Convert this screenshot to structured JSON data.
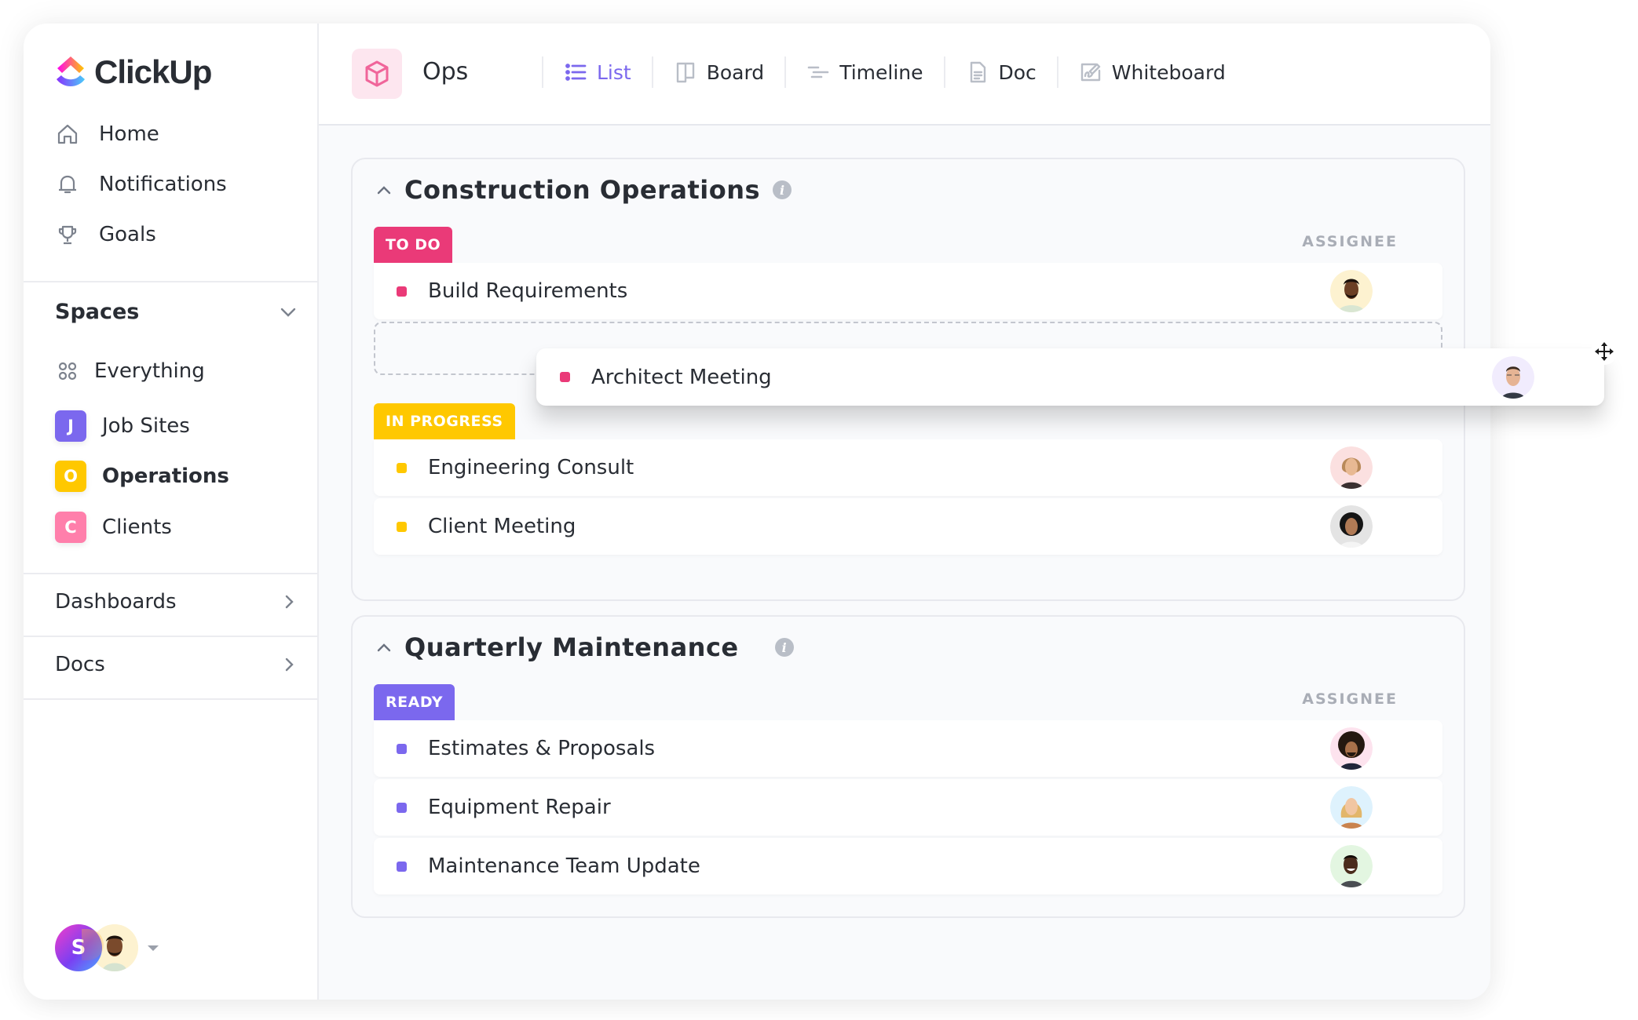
{
  "app": {
    "name": "ClickUp"
  },
  "sidebar": {
    "nav": [
      {
        "label": "Home",
        "icon": "home-icon"
      },
      {
        "label": "Notifications",
        "icon": "bell-icon"
      },
      {
        "label": "Goals",
        "icon": "trophy-icon"
      }
    ],
    "spaces_label": "Spaces",
    "everything_label": "Everything",
    "spaces": [
      {
        "initial": "J",
        "label": "Job Sites",
        "color": "#7b68ee"
      },
      {
        "initial": "O",
        "label": "Operations",
        "color": "#ffc800",
        "active": true
      },
      {
        "initial": "C",
        "label": "Clients",
        "color": "#ff7fab"
      }
    ],
    "dashboards_label": "Dashboards",
    "docs_label": "Docs",
    "user_initial": "S"
  },
  "header": {
    "space_title": "Ops",
    "tabs": [
      {
        "label": "List",
        "icon": "list-icon",
        "active": true
      },
      {
        "label": "Board",
        "icon": "board-icon"
      },
      {
        "label": "Timeline",
        "icon": "timeline-icon"
      },
      {
        "label": "Doc",
        "icon": "doc-icon"
      },
      {
        "label": "Whiteboard",
        "icon": "whiteboard-icon"
      }
    ]
  },
  "colors": {
    "accent": "#7b68ee",
    "todo": "#ea3a78",
    "in_progress": "#ffc800",
    "ready": "#7b68ee"
  },
  "lists": [
    {
      "title": "Construction Operations",
      "assignee_header": "ASSIGNEE",
      "groups": [
        {
          "status": "TO DO",
          "tasks": [
            {
              "name": "Build Requirements",
              "assignee": "man-beard-avatar"
            }
          ]
        },
        {
          "status": "IN PROGRESS",
          "tasks": [
            {
              "name": "Engineering Consult",
              "assignee": "woman-blonde-avatar"
            },
            {
              "name": "Client Meeting",
              "assignee": "woman-curly-avatar"
            }
          ]
        }
      ]
    },
    {
      "title": "Quarterly Maintenance",
      "assignee_header": "ASSIGNEE",
      "groups": [
        {
          "status": "READY",
          "tasks": [
            {
              "name": "Estimates & Proposals",
              "assignee": "man-afro-avatar"
            },
            {
              "name": "Equipment Repair",
              "assignee": "woman-light-hair-avatar"
            },
            {
              "name": "Maintenance Team Update",
              "assignee": "man-smiling-avatar"
            }
          ]
        }
      ]
    }
  ],
  "dragging_task": {
    "name": "Architect Meeting",
    "status": "TO DO",
    "assignee": "man-glasses-avatar"
  }
}
